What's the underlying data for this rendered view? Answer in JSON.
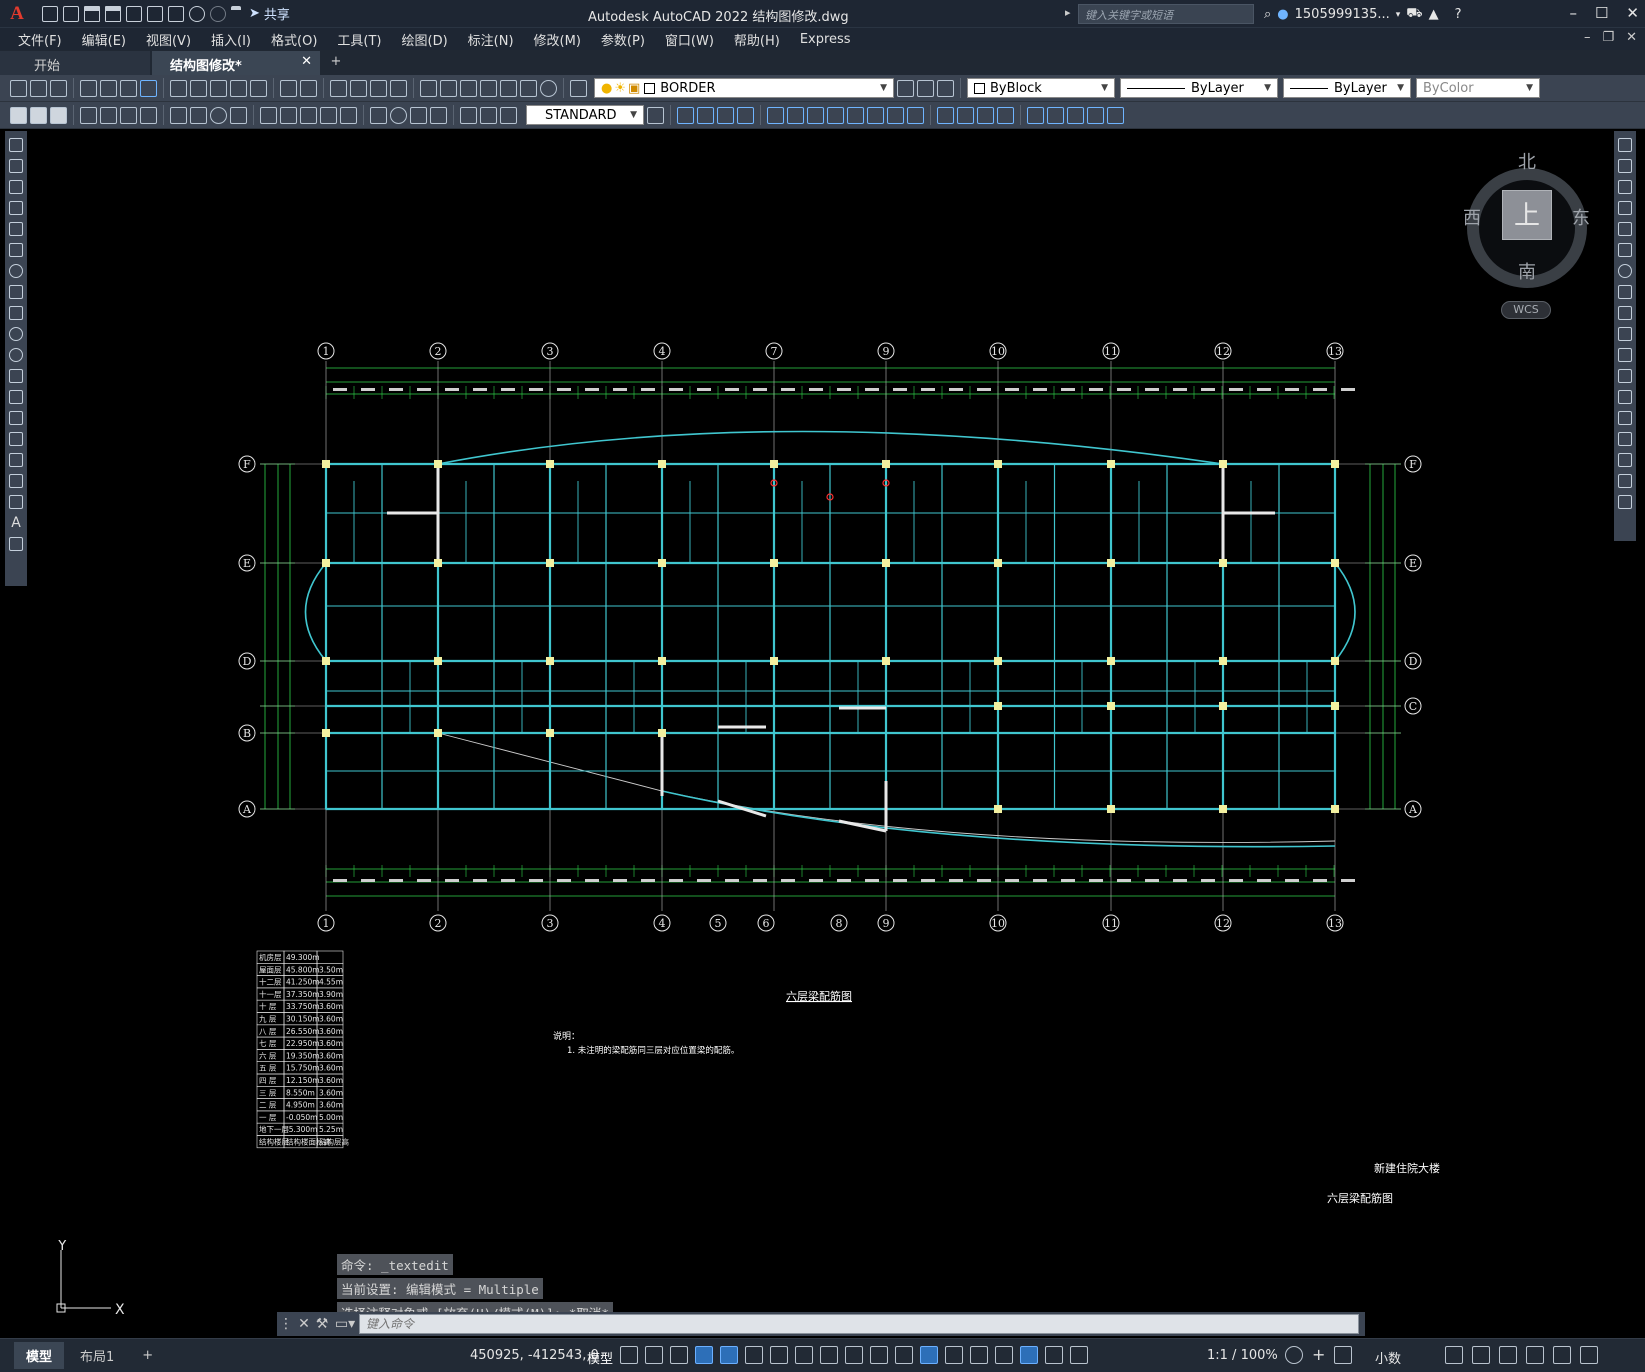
{
  "window": {
    "app_logo": "A",
    "title": "Autodesk AutoCAD 2022    结构图修改.dwg",
    "share_label": "共享",
    "search_placeholder": "键入关键字或短语",
    "user": "1505999135...",
    "icons": [
      "new-icon",
      "open-icon",
      "save-icon",
      "saveas-icon",
      "publish-icon",
      "print-icon",
      "undo-icon",
      "redo-icon",
      "share-icon",
      "search-icon",
      "user-icon",
      "cart-icon",
      "help-icon",
      "minimize-icon",
      "maximize-icon",
      "close-icon"
    ]
  },
  "menu": [
    "文件(F)",
    "编辑(E)",
    "视图(V)",
    "插入(I)",
    "格式(O)",
    "工具(T)",
    "绘图(D)",
    "标注(N)",
    "修改(M)",
    "参数(P)",
    "窗口(W)",
    "帮助(H)",
    "Express"
  ],
  "tabs": {
    "start": "开始",
    "active": "结构图修改*",
    "close": "✕",
    "add": "+"
  },
  "toolbar": {
    "layer": "BORDER",
    "color": "ByBlock",
    "linetype": "ByLayer",
    "lineweight": "ByLayer",
    "plotstyle": "ByColor",
    "textstyle": "STANDARD"
  },
  "viewcube": {
    "north": "北",
    "south": "南",
    "east": "东",
    "west": "西",
    "top": "上",
    "wcs": "WCS"
  },
  "drawing": {
    "grid_columns_top": [
      "1",
      "2",
      "3",
      "4",
      "7",
      "9",
      "10",
      "11",
      "12",
      "13"
    ],
    "grid_columns_bottom": [
      "1",
      "2",
      "3",
      "4",
      "5",
      "6",
      "8",
      "9",
      "10",
      "11",
      "12",
      "13"
    ],
    "grid_rows_left": [
      "F",
      "E",
      "D",
      "B",
      "A"
    ],
    "grid_rows_right": [
      "F",
      "E",
      "D",
      "C",
      "A"
    ],
    "plan_title": "六层梁配筋图",
    "notes_title": "说明：",
    "notes_item": "1. 未注明的梁配筋同三层对应位置梁的配筋。",
    "project_name": "新建住院大楼",
    "sheet_name": "六层梁配筋图",
    "floor_table": [
      [
        "机房层",
        "49.300m",
        ""
      ],
      [
        "屋面层",
        "45.800m",
        "3.50m"
      ],
      [
        "十二层",
        "41.250m",
        "4.55m"
      ],
      [
        "十一层",
        "37.350m",
        "3.90m"
      ],
      [
        "十 层",
        "33.750m",
        "3.60m"
      ],
      [
        "九 层",
        "30.150m",
        "3.60m"
      ],
      [
        "八 层",
        "26.550m",
        "3.60m"
      ],
      [
        "七 层",
        "22.950m",
        "3.60m"
      ],
      [
        "六 层",
        "19.350m",
        "3.60m"
      ],
      [
        "五 层",
        "15.750m",
        "3.60m"
      ],
      [
        "四 层",
        "12.150m",
        "3.60m"
      ],
      [
        "三 层",
        "8.550m",
        "3.60m"
      ],
      [
        "二 层",
        "4.950m",
        "3.60m"
      ],
      [
        "一 层",
        "-0.050m",
        "5.00m"
      ],
      [
        "地下一层",
        "-5.300m",
        "5.25m"
      ],
      [
        "结构楼层",
        "结构楼面标高",
        "结构层高"
      ]
    ]
  },
  "command": {
    "history": [
      "命令: _textedit",
      "当前设置: 编辑模式 = Multiple",
      "选择注释对象或 [放弃(U)/模式(M)]: *取消*"
    ],
    "placeholder": "键入命令"
  },
  "ucs": {
    "x": "X",
    "y": "Y"
  },
  "status": {
    "layout_model": "模型",
    "layout_1": "布局1",
    "add": "+",
    "coords": "450925, -412543, 0",
    "model": "模型",
    "scale": "1:1 / 100%",
    "units": "小数"
  }
}
